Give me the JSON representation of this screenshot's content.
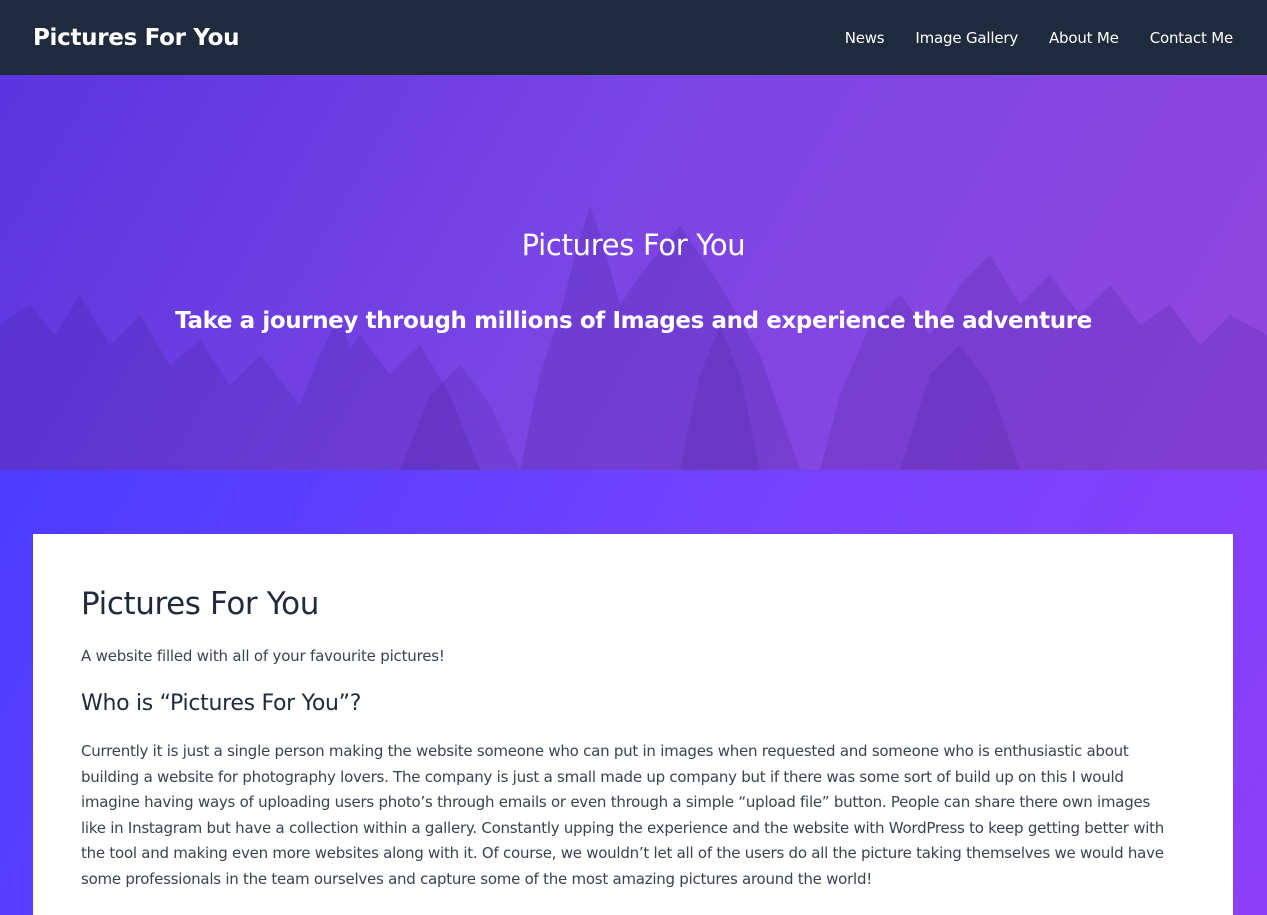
{
  "header": {
    "site_title": "Pictures For You",
    "nav": [
      "News",
      "Image Gallery",
      "About Me",
      "Contact Me"
    ]
  },
  "hero": {
    "title": "Pictures For You",
    "subtitle": "Take a journey through millions of Images and experience the adventure"
  },
  "content": {
    "heading": "Pictures For You",
    "tagline": "A website filled with all of your favourite pictures!",
    "subheading": "Who is “Pictures For You”?",
    "body": "Currently it is just a single person making the website someone who can put in images when requested and someone who is enthusiastic about building a website for photography lovers. The company is just a small made up company but if there was some sort of build up on this I would imagine having ways of uploading users photo’s through emails or even through a simple “upload file” button. People can share there own images like in Instagram but have a collection within a gallery. Constantly upping the experience and the website with WordPress to keep getting better with the tool and making even more websites along with it. Of course, we wouldn’t let all of the users do all the picture taking themselves we would have some professionals in the team ourselves and capture some of the most amazing pictures around the world!"
  },
  "colors": {
    "header_bg": "#1f2a3c",
    "hero_gradient_start": "#5a34df",
    "hero_gradient_end": "#9246de",
    "lower_gradient_start": "#4b3cff",
    "lower_gradient_end": "#8c3ff7"
  }
}
